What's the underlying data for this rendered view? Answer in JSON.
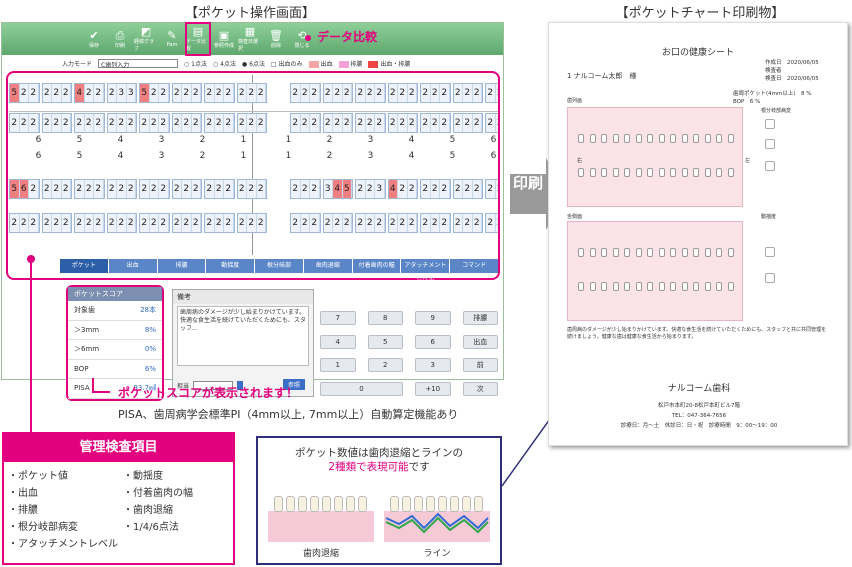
{
  "titles": {
    "left": "【ポケット操作画面】",
    "right": "【ポケットチャート印刷物】"
  },
  "toolbar": [
    {
      "icon": "check-icon",
      "label": "保存"
    },
    {
      "icon": "print-icon",
      "label": "印刷"
    },
    {
      "icon": "graph-icon",
      "label": "経緯グラフ"
    },
    {
      "icon": "pen-icon",
      "label": "Pam"
    },
    {
      "icon": "compare-icon",
      "label": "データ比較"
    },
    {
      "icon": "doc-icon",
      "label": "参照作成"
    },
    {
      "icon": "calendar-icon",
      "label": "検査日選択"
    },
    {
      "icon": "trash-icon",
      "label": "削除"
    },
    {
      "icon": "close-icon",
      "label": "閉じる"
    }
  ],
  "callout_compare": "データ比較",
  "modebar": {
    "label": "入力モード",
    "select": "C歯列入力",
    "options": [
      "1点法",
      "4点法",
      "6点法",
      "出血のみ"
    ],
    "legend": [
      "出血",
      "排膿",
      "出血・排膿"
    ]
  },
  "rows": {
    "r1a": [
      "5",
      "2",
      "2",
      "2",
      "2",
      "2",
      "4",
      "2",
      "2",
      "2",
      "3",
      "3",
      "5",
      "2",
      "2",
      "2",
      "2",
      "2",
      "2",
      "2",
      "2",
      "2",
      "2",
      "2"
    ],
    "r1b": [
      "2",
      "2",
      "2",
      "2",
      "2",
      "2",
      "2",
      "2",
      "2",
      "2",
      "2",
      "2",
      "2",
      "2",
      "2",
      "2",
      "2",
      "2",
      "2",
      "2",
      "2",
      "2",
      "2",
      "2"
    ],
    "r2a": [
      "5",
      "6",
      "2",
      "2",
      "2",
      "2",
      "2",
      "2",
      "2",
      "2",
      "2",
      "2",
      "2",
      "2",
      "2",
      "2",
      "2",
      "2",
      "2",
      "2",
      "2",
      "2",
      "2",
      "2"
    ],
    "r2b": [
      "2",
      "2",
      "2",
      "2",
      "2",
      "2",
      "2",
      "2",
      "2",
      "2",
      "2",
      "2",
      "2",
      "2",
      "2",
      "2",
      "2",
      "2",
      "2",
      "2",
      "2",
      "2",
      "2",
      "2"
    ],
    "r1ra": [
      "2",
      "2",
      "2",
      "2",
      "2",
      "2",
      "2",
      "2",
      "2",
      "2",
      "2",
      "2",
      "2",
      "2",
      "2",
      "2",
      "2",
      "2",
      "2",
      "2",
      "2",
      "2",
      "2",
      "5"
    ],
    "r1rb": [
      "2",
      "2",
      "2",
      "2",
      "2",
      "2",
      "2",
      "2",
      "2",
      "2",
      "2",
      "2",
      "2",
      "2",
      "2",
      "2",
      "2",
      "2",
      "2",
      "2",
      "2",
      "2",
      "2",
      "2"
    ],
    "r2ra": [
      "2",
      "2",
      "2",
      "3",
      "4",
      "5",
      "2",
      "2",
      "3",
      "4",
      "2",
      "2",
      "2",
      "2",
      "2",
      "2",
      "2",
      "2",
      "2",
      "2",
      "2",
      "2",
      "2",
      "2"
    ],
    "r2rb": [
      "2",
      "2",
      "2",
      "2",
      "2",
      "2",
      "2",
      "2",
      "2",
      "2",
      "2",
      "2",
      "2",
      "2",
      "2",
      "2",
      "2",
      "2",
      "2",
      "2",
      "2",
      "2",
      "2",
      "2"
    ]
  },
  "tooth_numbers": {
    "left": [
      "6",
      "5",
      "4",
      "3",
      "2",
      "1"
    ],
    "right": [
      "1",
      "2",
      "3",
      "4",
      "5",
      "6"
    ]
  },
  "tabs": [
    "ポケット",
    "出血",
    "排膿",
    "動揺度",
    "根分岐部",
    "歯肉退縮",
    "付着歯肉の幅",
    "アタッチメントレベル",
    "コマンド"
  ],
  "score": {
    "title": "ポケットスコア",
    "rows": [
      {
        "label": "対象歯",
        "value": "28本"
      },
      {
        "label": "＞3mm",
        "value": "8%"
      },
      {
        "label": "＞6mm",
        "value": "0%"
      },
      {
        "label": "BOP",
        "value": "6%"
      },
      {
        "label": "PISA",
        "value": "93.7㎟"
      }
    ]
  },
  "note": {
    "title": "備考",
    "text": "歯周病のダメージが少し始まりかけています。快適な食生活を続けていただくためにも、スタッフ...",
    "staff": "担当",
    "ref": "参照"
  },
  "keypad": [
    "7",
    "8",
    "9",
    "排膿",
    "4",
    "5",
    "6",
    "出血",
    "1",
    "2",
    "3",
    "前",
    "0",
    "",
    "+10",
    "次"
  ],
  "callout_score": "ポケットスコアが表示されます！",
  "score_desc": "PISA、歯周病学会標準PI（4mm以上, 7mm以上）自動算定機能あり",
  "mgmt": {
    "title": "管理検査項目",
    "col1": [
      "・ポケット値",
      "・出血",
      "・排膿",
      "・根分岐部病変",
      "・アタッチメントレベル"
    ],
    "col2": [
      "・動揺度",
      "・付着歯肉の幅",
      "・歯肉退縮",
      "・1/4/6点法"
    ]
  },
  "pocketbox": {
    "line1": "ポケット数値は歯肉退縮とラインの",
    "line2": "2種類で表現可能",
    "line2b": "です",
    "cap1": "歯肉退縮",
    "cap2": "ライン"
  },
  "arrow": "印刷",
  "sheet": {
    "title": "お口の健康シート",
    "patient": "1 ナルコーム太郎　様",
    "dates": [
      "作成日　2020/06/05",
      "検査者",
      "検査日　2020/06/05"
    ],
    "pocket": "歯周ポケット(4mm以上)　8 %",
    "bop": "BOP　6 %",
    "upper": "歯列画",
    "lower": "舌側面",
    "mobility": "根分岐部病変",
    "mobility2": "動揺度",
    "right": "右",
    "left": "左",
    "comment": "歯周病のダメージが少し始まりかけています。快適な食生活を続けていただくためにも、スタッフと共に共同管理を続けましょう。健康な歯は健康な食生活から始まります。",
    "clinic": "ナルコーム歯科",
    "address": "松戸市本町20-8松戸本町ビル7階",
    "tel": "TEL：047-364-7656",
    "hours": "診療日：月〜土　休診日：日・祝　診療時間　9：00〜19：00"
  }
}
